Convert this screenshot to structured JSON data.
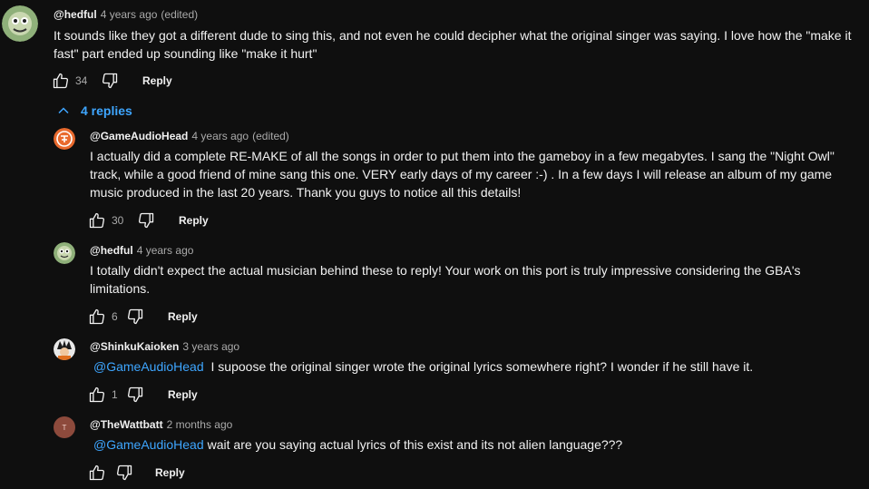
{
  "top_comment": {
    "author": "@hedful",
    "time": "4 years ago",
    "edited": "(edited)",
    "text": "It sounds like they got a different dude to sing this, and not even he could decipher what the original singer was saying. I love how the \"make it fast\" part ended up sounding like \"make it hurt\"",
    "likes": "34",
    "reply_label": "Reply"
  },
  "replies_toggle": {
    "label": "4 replies"
  },
  "replies": [
    {
      "author": "@GameAudioHead",
      "time": "4 years ago",
      "edited": "(edited)",
      "mention": "",
      "text": "I actually did a complete RE-MAKE of all the songs in order to put them into the gameboy in a few megabytes. I sang the \"Night Owl\" track, while a good friend of mine sang this one. VERY early days of my career :-) . In a few days I will release an album of my game music produced in the last 20 years. Thank you guys to notice all this details!",
      "likes": "30",
      "reply_label": "Reply"
    },
    {
      "author": "@hedful",
      "time": "4 years ago",
      "edited": "",
      "mention": "",
      "text": "I totally didn't expect the actual musician behind these to reply! Your work on this port is truly impressive considering the GBA's limitations.",
      "likes": "6",
      "reply_label": "Reply"
    },
    {
      "author": "@ShinkuKaioken",
      "time": "3 years ago",
      "edited": "",
      "mention": "@GameAudioHead",
      "text": "I supoose the original singer wrote the original lyrics somewhere right? I wonder if he still have it.",
      "likes": "1",
      "reply_label": "Reply"
    },
    {
      "author": "@TheWattbatt",
      "time": "2 months ago",
      "edited": "",
      "mention": "@GameAudioHead",
      "text": "wait are you saying actual lyrics of this exist and its not alien language???",
      "likes": "",
      "reply_label": "Reply",
      "avatar_letter": "T"
    }
  ],
  "colors": {
    "background": "#0f0f0f",
    "link": "#3ea6ff",
    "secondary_text": "#aaaaaa"
  }
}
